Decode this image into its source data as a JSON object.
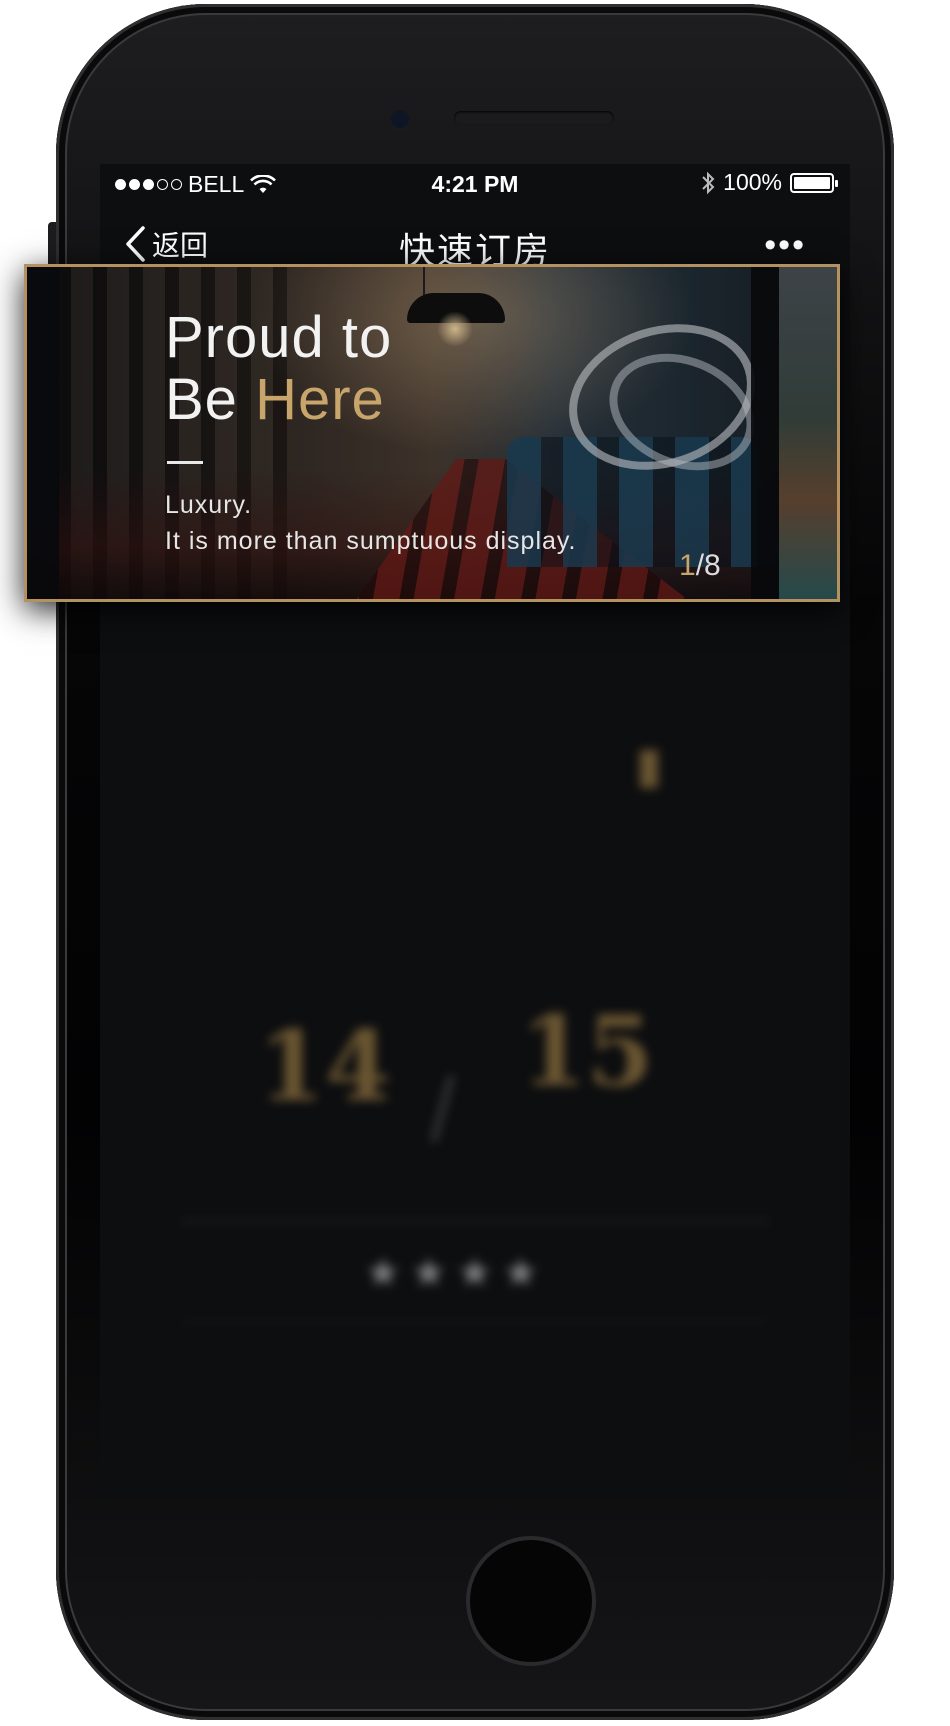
{
  "status_bar": {
    "carrier": "BELL",
    "time": "4:21 PM",
    "battery": "100%",
    "battery_level": 1.0,
    "signal_bars_filled": 3,
    "signal_bars_total": 5
  },
  "nav": {
    "back_label": "返回",
    "title": "快速订房",
    "more_glyph": "•••"
  },
  "banner": {
    "title_line1": "Proud to",
    "title_line2_prefix": "Be ",
    "title_line2_accent": "Here",
    "subtitle_line1": "Luxury.",
    "subtitle_line2": "It is more than sumptuous display.",
    "counter_current": "1",
    "counter_total": "/8",
    "accent_color": "#c8a56a",
    "border_color": "#b39160"
  },
  "background_content": {
    "checkin_day": "14",
    "checkout_day": "15",
    "star_glyphs": "★★★★"
  }
}
